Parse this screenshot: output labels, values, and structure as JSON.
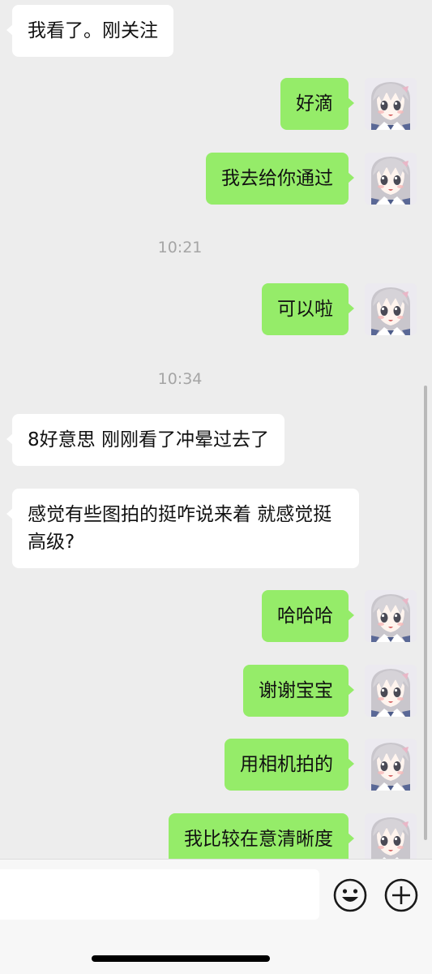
{
  "messages": [
    {
      "side": "in",
      "text": "我看了。刚关注"
    },
    {
      "side": "out",
      "text": "好滴"
    },
    {
      "side": "out",
      "text": "我去给你通过"
    },
    {
      "time": "10:21"
    },
    {
      "side": "out",
      "text": "可以啦"
    },
    {
      "time": "10:34"
    },
    {
      "side": "in",
      "text": "8好意思 刚刚看了冲晕过去了"
    },
    {
      "side": "in",
      "text": "感觉有些图拍的挺咋说来着 就感觉挺高级?"
    },
    {
      "side": "out",
      "text": "哈哈哈"
    },
    {
      "side": "out",
      "text": "谢谢宝宝"
    },
    {
      "side": "out",
      "text": "用相机拍的"
    },
    {
      "side": "out",
      "text": "我比较在意清晰度"
    }
  ],
  "input": {
    "value": "",
    "placeholder": ""
  },
  "icons": {
    "emoji": "emoji-icon",
    "add": "plus-circle-icon"
  },
  "colors": {
    "background": "#ededed",
    "incoming_bubble": "#ffffff",
    "outgoing_bubble": "#95ec69",
    "timestamp": "#a5a5a5"
  }
}
